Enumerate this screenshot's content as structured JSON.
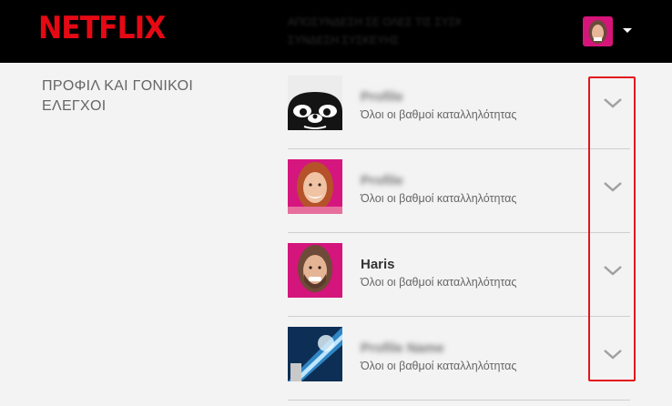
{
  "header": {
    "logo_text": "NETFLIX",
    "notice_line1": "ΑΠΟΣΥΝΔΕΣΗ ΣΕ ΟΛΕΣ ΤΙΣ ΣΥΣΚΕΥΕΣ",
    "notice_line2": "ΣΥΝΔΕΣΗ ΣΥΣΚΕΥΗΣ",
    "account_avatar_icon": "profile-avatar",
    "menu_icon": "caret-down-icon"
  },
  "section_title": "ΠΡΟΦΙΛ ΚΑΙ ΓΟΝΙΚΟΙ ΕΛΕΓΧΟΙ",
  "profiles": [
    {
      "name": "Profile",
      "name_hidden": true,
      "rating": "Όλοι οι βαθμοί καταλληλότητας",
      "avatar": "panda-avatar-icon"
    },
    {
      "name": "Profile",
      "name_hidden": true,
      "rating": "Όλοι οι βαθμοί καταλληλότητας",
      "avatar": "redhead-avatar-icon"
    },
    {
      "name": "Haris",
      "name_hidden": false,
      "rating": "Όλοι οι βαθμοί καταλληλότητας",
      "avatar": "bearded-man-avatar-icon"
    },
    {
      "name": "Profile Name",
      "name_hidden": true,
      "rating": "Όλοι οι βαθμοί καταλληλότητας",
      "avatar": "blue-light-avatar-icon"
    }
  ],
  "colors": {
    "brand": "#e50914",
    "highlight": "#e3141b",
    "background": "#f3f3f3",
    "header": "#000000"
  }
}
